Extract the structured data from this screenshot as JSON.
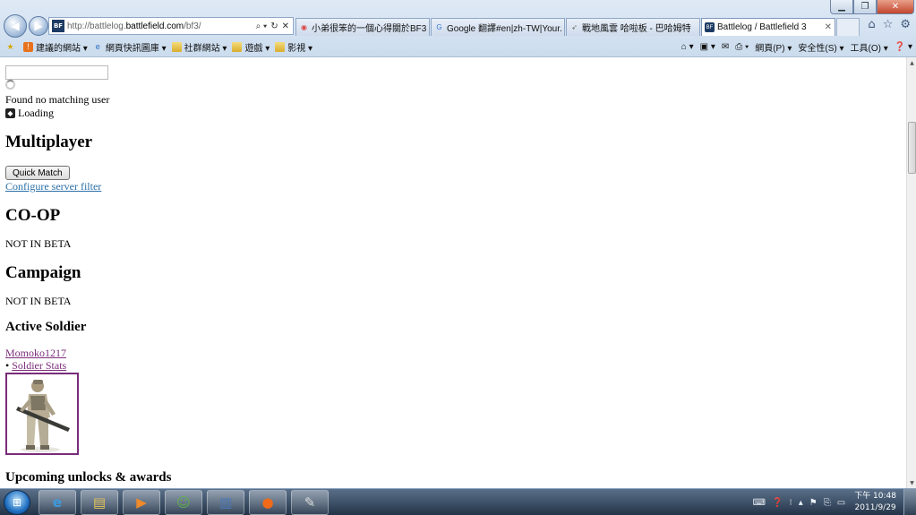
{
  "window": {
    "minimize": "▁",
    "maximize": "❐",
    "close": "✕"
  },
  "nav": {
    "back_icon": "arrow-left",
    "forward_icon": "arrow-right"
  },
  "address": {
    "favicon": "BF",
    "url_prefix": "http://battlelog.",
    "url_domain": "battlefield.com",
    "url_suffix": "/bf3/",
    "tools": [
      "⌕ ▾",
      "↻",
      "✕"
    ]
  },
  "tabs": [
    {
      "label": "小弟很笨的一個心得關於BF3 b...",
      "icon": "◉",
      "icon_color": "#d44"
    },
    {
      "label": "Google 翻譯#en|zh-TW|Your...",
      "icon": "G",
      "icon_color": "#3a78d6"
    },
    {
      "label": "戰地風雲 哈啦板 - 巴哈姆特",
      "icon": "➶",
      "icon_color": "#666"
    },
    {
      "label": "Battlelog / Battlefield 3",
      "icon": "BF",
      "icon_color": "#1e3b63",
      "active": true
    }
  ],
  "toolbar_right": [
    "⌂",
    "☆",
    "⚙"
  ],
  "favorites": [
    {
      "label": "",
      "icon": "★"
    },
    {
      "label": "建議的網站 ▾",
      "icon": "!"
    },
    {
      "label": "網頁快訊圖庫 ▾",
      "icon": "e"
    },
    {
      "label": "社群網站 ▾",
      "icon": "folder"
    },
    {
      "label": "遊戲 ▾",
      "icon": "folder"
    },
    {
      "label": "影視 ▾",
      "icon": "folder"
    }
  ],
  "commands": [
    "⌂ ▾",
    "▣ ▾",
    "✉",
    "⎙ ▾",
    "網頁(P) ▾",
    "安全性(S) ▾",
    "工具(O) ▾",
    "❓ ▾"
  ],
  "page": {
    "no_match": "Found no matching user",
    "loading": "Loading",
    "multiplayer_heading": "Multiplayer",
    "quick_match": "Quick Match",
    "configure_filter": "Configure server filter",
    "coop_heading": "CO-OP",
    "coop_status": "NOT IN BETA",
    "campaign_heading": "Campaign",
    "campaign_status": "NOT IN BETA",
    "active_soldier_heading": "Active Soldier",
    "soldier_name": "Momoko1217",
    "bullet": "•",
    "soldier_stats": "Soldier Stats",
    "unlocks_heading": "Upcoming unlocks & awards"
  },
  "taskbar": {
    "start_icon": "windows-logo",
    "apps": [
      {
        "name": "internet-explorer",
        "glyph": "e",
        "color": "#3b9be0"
      },
      {
        "name": "file-explorer",
        "glyph": "▤",
        "color": "#e8c35a"
      },
      {
        "name": "media-player",
        "glyph": "▶",
        "color": "#f08a2a"
      },
      {
        "name": "messenger",
        "glyph": "☺",
        "color": "#5fb24a"
      },
      {
        "name": "application",
        "glyph": "▥",
        "color": "#4a78b8"
      },
      {
        "name": "origin",
        "glyph": "●",
        "color": "#f06a1a"
      },
      {
        "name": "paint",
        "glyph": "✎",
        "color": "#ddd"
      }
    ],
    "tray_icons": [
      "⌨",
      "❓",
      "⁝",
      "▴",
      "⚑",
      "⎘",
      "▭"
    ],
    "time": "下午 10:48",
    "date": "2011/9/29"
  }
}
